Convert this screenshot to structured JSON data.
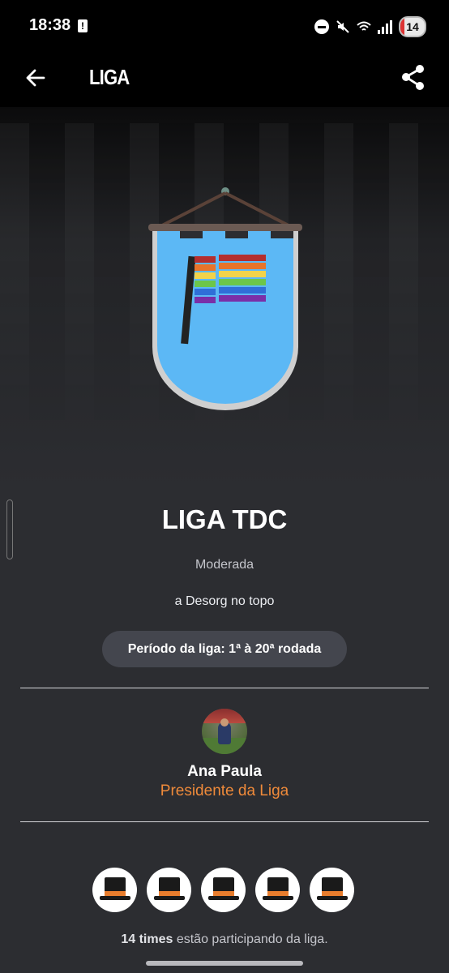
{
  "status_bar": {
    "time": "18:38",
    "alert_glyph": "!",
    "battery_level": "14",
    "icons": [
      "do-not-disturb-icon",
      "mute-icon",
      "wifi-icon",
      "signal-icon",
      "battery-icon"
    ]
  },
  "app_bar": {
    "title": "LIGA",
    "back_icon": "arrow-left-icon",
    "share_icon": "share-icon"
  },
  "league": {
    "name": "LIGA TDC",
    "type": "Moderada",
    "description": "a Desorg no topo",
    "period": "Período da liga: 1ª à 20ª rodada",
    "emblem": {
      "pennant_color": "#5cb8f5",
      "flag_colors": [
        "#b42e2e",
        "#e8742a",
        "#f1d34a",
        "#6cc64a",
        "#2f6fd8",
        "#7a2fa8"
      ]
    }
  },
  "president": {
    "name": "Ana Paula",
    "role": "Presidente da Liga"
  },
  "teams": {
    "badges": [
      "team-badge",
      "team-badge",
      "team-badge",
      "team-badge",
      "team-badge"
    ],
    "count_bold": "14 times",
    "count_rest": " estão participando da liga."
  },
  "colors": {
    "accent": "#ef8a3a",
    "background": "#2c2d31",
    "pill": "#44464e"
  }
}
